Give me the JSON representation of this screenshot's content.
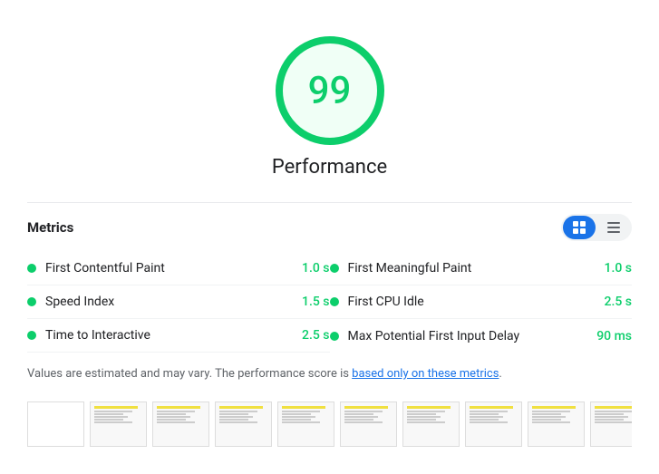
{
  "score": {
    "value": "99",
    "label": "Performance",
    "color": "#0cce6b"
  },
  "metrics": {
    "title": "Metrics",
    "toggle": {
      "list_icon": "≡",
      "grid_icon": "⊟"
    },
    "items": [
      {
        "name": "First Contentful Paint",
        "value": "1.0 s",
        "status": "good"
      },
      {
        "name": "First Meaningful Paint",
        "value": "1.0 s",
        "status": "good"
      },
      {
        "name": "Speed Index",
        "value": "1.5 s",
        "status": "good"
      },
      {
        "name": "First CPU Idle",
        "value": "2.5 s",
        "status": "good"
      },
      {
        "name": "Time to Interactive",
        "value": "2.5 s",
        "status": "good"
      },
      {
        "name": "Max Potential First Input Delay",
        "value": "90 ms",
        "status": "good"
      }
    ],
    "note_prefix": "Values are estimated and may vary. The performance score is ",
    "note_link": "based only on these metrics",
    "note_suffix": "."
  },
  "filmstrip": {
    "frames": [
      "frame-1",
      "frame-2",
      "frame-3",
      "frame-4",
      "frame-5",
      "frame-6",
      "frame-7",
      "frame-8",
      "frame-9",
      "frame-10"
    ]
  }
}
